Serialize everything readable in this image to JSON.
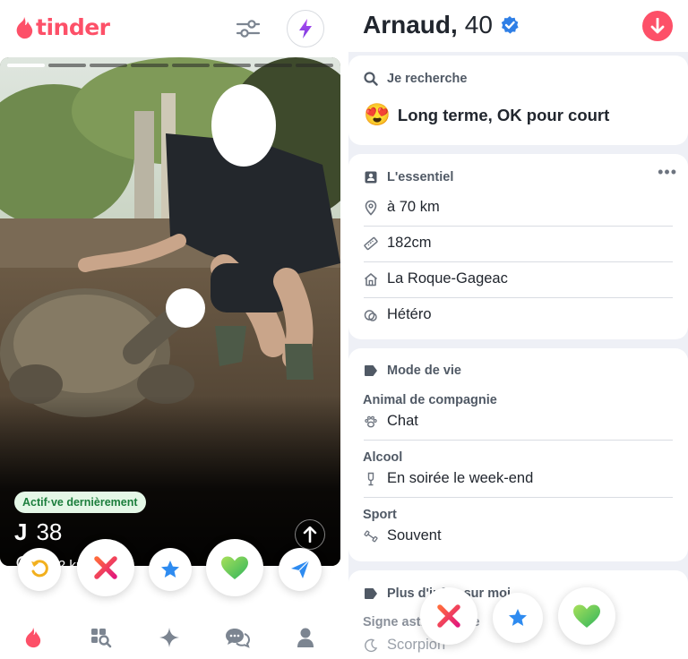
{
  "app": {
    "logo_text": "tinder",
    "brand_color": "#fd5068"
  },
  "header_icons": {
    "filter": "sliders-icon",
    "boost": "lightning-bolt-icon"
  },
  "card": {
    "active_badge": "Actif·ve dernièrement",
    "name": "J",
    "age": "38",
    "distance": "à 12 km",
    "photo_count": 8,
    "active_photo_index": 1
  },
  "actions": [
    {
      "name": "rewind",
      "icon": "rewind-icon"
    },
    {
      "name": "nope",
      "icon": "x-icon"
    },
    {
      "name": "super-like",
      "icon": "star-icon"
    },
    {
      "name": "like",
      "icon": "heart-icon"
    },
    {
      "name": "boost-send",
      "icon": "paper-plane-icon"
    }
  ],
  "navbar": [
    "flame-icon",
    "explore-icon",
    "sparkle-icon",
    "chat-icon",
    "profile-icon"
  ],
  "profile": {
    "name": "Arnaud,",
    "age": "40",
    "verified": true,
    "looking_for": {
      "title": "Je recherche",
      "emoji": "😍",
      "value": "Long terme, OK pour court"
    },
    "essentials": {
      "title": "L'essentiel",
      "more": "•••",
      "items": [
        {
          "icon": "location-pin-icon",
          "text": "à 70 km"
        },
        {
          "icon": "ruler-icon",
          "text": "182cm"
        },
        {
          "icon": "home-icon",
          "text": "La Roque-Gageac"
        },
        {
          "icon": "orientation-icon",
          "text": "Hétéro"
        }
      ]
    },
    "lifestyle": {
      "title": "Mode de vie",
      "groups": [
        {
          "label": "Animal de compagnie",
          "icon": "paw-icon",
          "value": "Chat"
        },
        {
          "label": "Alcool",
          "icon": "glass-icon",
          "value": "En soirée le week-end"
        },
        {
          "label": "Sport",
          "icon": "dumbbell-icon",
          "value": "Souvent"
        }
      ]
    },
    "more_about": {
      "title": "Plus d'infos sur moi",
      "label": "Signe astrologique",
      "value": "Scorpion"
    }
  }
}
